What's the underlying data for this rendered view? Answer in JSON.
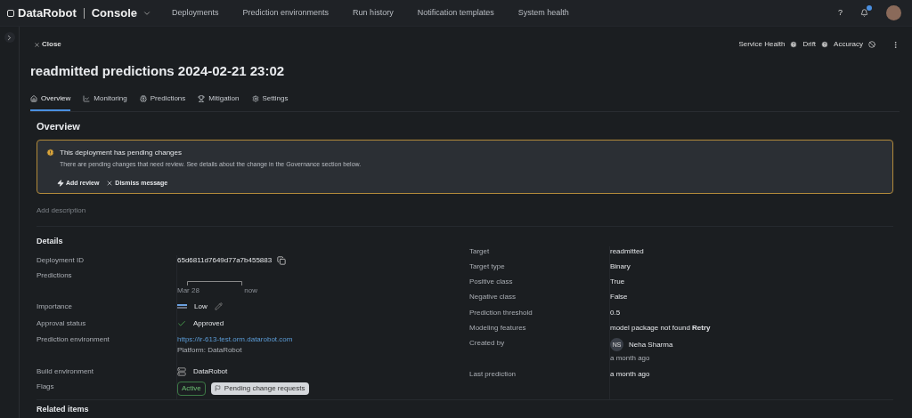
{
  "topbar": {
    "logo_brand": "DataRobot",
    "logo_product": "Console",
    "nav": [
      {
        "label": "Deployments",
        "selected": false
      },
      {
        "label": "Prediction environments",
        "selected": false
      },
      {
        "label": "Run history",
        "selected": false
      },
      {
        "label": "Notification templates",
        "selected": false
      },
      {
        "label": "System health",
        "selected": false
      }
    ],
    "help": "?"
  },
  "close": "Close",
  "health": [
    {
      "label": "Service Health",
      "kind": "unknown"
    },
    {
      "label": "Drift",
      "kind": "unknown"
    },
    {
      "label": "Accuracy",
      "kind": "disabled"
    }
  ],
  "title": "readmitted predictions 2024-02-21 23:02",
  "tabs": [
    {
      "label": "Overview",
      "selected": true
    },
    {
      "label": "Monitoring",
      "selected": false
    },
    {
      "label": "Predictions",
      "selected": false
    },
    {
      "label": "Mitigation",
      "selected": false
    },
    {
      "label": "Settings",
      "selected": false
    }
  ],
  "section_title": "Overview",
  "alert": {
    "title": "This deployment has pending changes",
    "text": "There are pending changes that need review. See details about the change in the Governance section below.",
    "actions": [
      {
        "label": "Add review",
        "kind": "review"
      },
      {
        "label": "Dismiss message",
        "kind": "dismiss"
      }
    ]
  },
  "description_placeholder": "Add description",
  "details_title": "Details",
  "details_left": [
    {
      "label": "Deployment ID",
      "kind": "id",
      "value": "65d6811d7649d77a7b455883"
    },
    {
      "label": "Predictions",
      "kind": "timeline",
      "start": "Mar 28",
      "end": "now"
    },
    {
      "label": "Importance",
      "kind": "importance",
      "value": "Low"
    },
    {
      "label": "Approval status",
      "kind": "status",
      "value": "Approved"
    },
    {
      "label": "Prediction environment",
      "kind": "link",
      "value": "https://ir-613-test.orm.datarobot.com",
      "sub": "Platform: DataRobot"
    },
    {
      "label": "Build environment",
      "kind": "environment",
      "value": "DataRobot"
    },
    {
      "label": "Flags",
      "kind": "flags",
      "flags": [
        {
          "text": "Active",
          "kind": "active"
        },
        {
          "text": "Pending change requests",
          "kind": "pending"
        }
      ]
    }
  ],
  "details_right": [
    {
      "label": "Target",
      "kind": "text",
      "value": "readmitted"
    },
    {
      "label": "Target type",
      "kind": "text",
      "value": "Binary"
    },
    {
      "label": "Positive class",
      "kind": "text",
      "value": "True"
    },
    {
      "label": "Negative class",
      "kind": "text",
      "value": "False"
    },
    {
      "label": "Prediction threshold",
      "kind": "text",
      "value": "0.5"
    },
    {
      "label": "Modeling features",
      "kind": "text",
      "value": "model package not found **Retry**"
    },
    {
      "label": "Created by",
      "kind": "user",
      "initials": "NS",
      "value": "Neha Sharma",
      "sub": "a month ago"
    },
    {
      "label": "Last prediction",
      "kind": "text",
      "value": "a month ago"
    }
  ],
  "related_title": "Related items"
}
